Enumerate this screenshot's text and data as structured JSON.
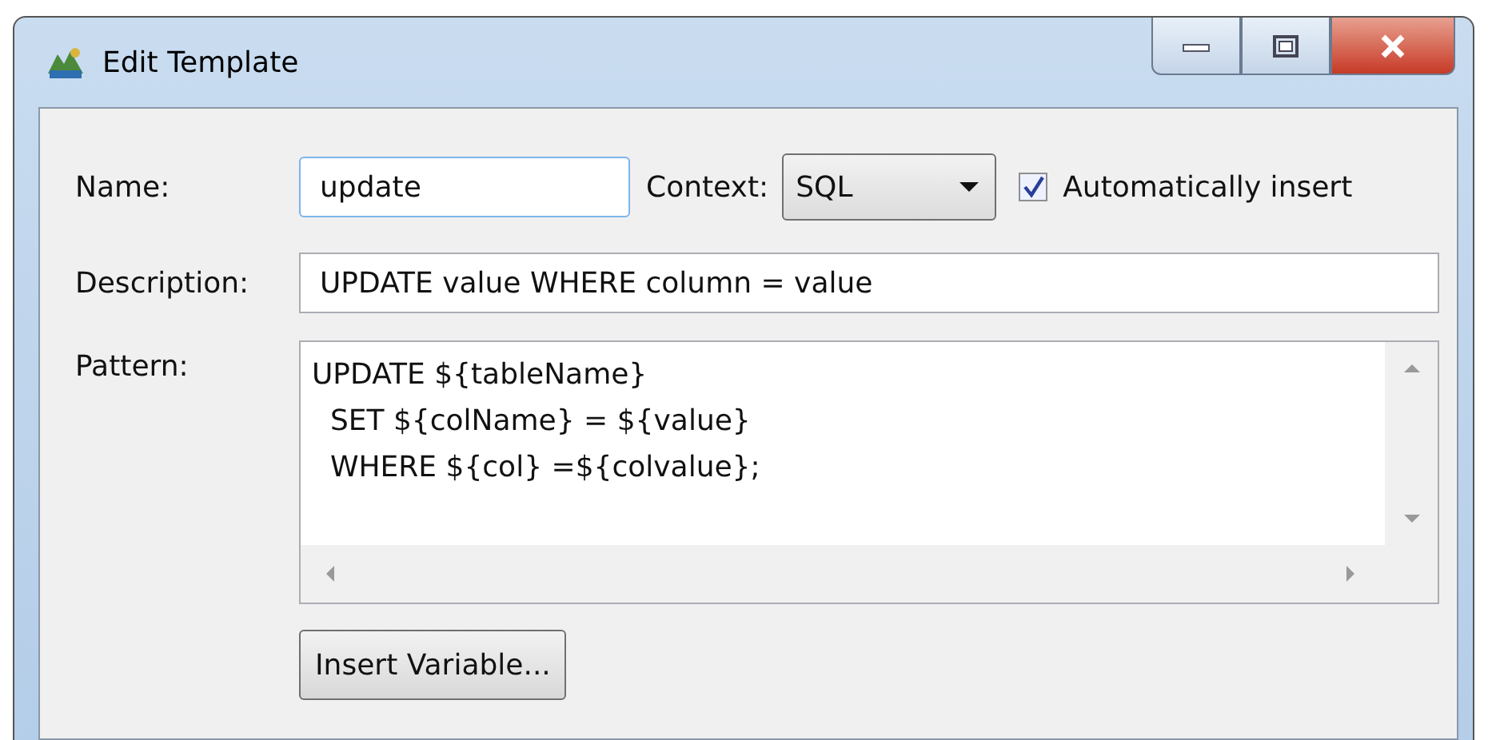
{
  "window": {
    "title": "Edit Template"
  },
  "name": {
    "label": "Name:",
    "value": "update"
  },
  "context": {
    "label": "Context:",
    "value": "SQL"
  },
  "auto_insert": {
    "label": "Automatically insert",
    "checked": true
  },
  "description": {
    "label": "Description:",
    "value": "UPDATE value WHERE column = value"
  },
  "pattern": {
    "label": "Pattern:",
    "lines": [
      "UPDATE ${tableName}",
      "  SET ${colName} = ${value}",
      "  WHERE ${col} =${colvalue};"
    ]
  },
  "buttons": [
    "Insert Variable..."
  ]
}
